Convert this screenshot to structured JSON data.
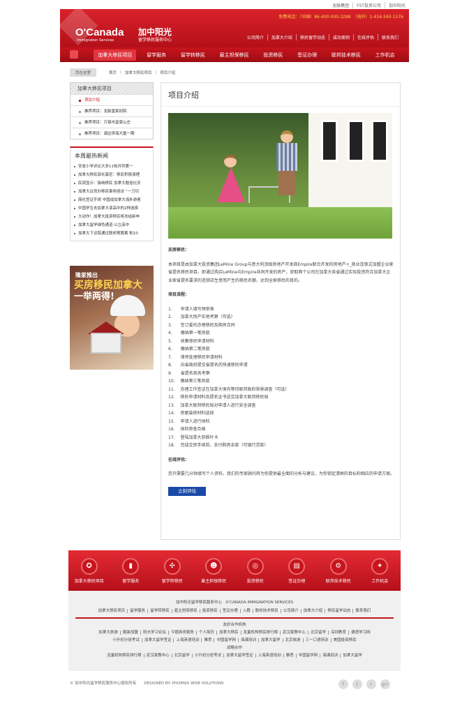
{
  "top_links": [
    "龙脉集团",
    "FST投资公司",
    "加中阳光"
  ],
  "header": {
    "logo_en": "O'Canada",
    "logo_sub": "Immigration Services",
    "logo_cn": "加中阳光",
    "logo_cn_sub": "留学移民服务中心",
    "phone": "免费电话：（中国）86-400-000-3288　（海外）1-416-590-1576",
    "subnav": [
      "公司简介",
      "加拿大介绍",
      "移民留学动态",
      "成功案例",
      "在线评估",
      "联系我们"
    ]
  },
  "main_nav": [
    "加拿大移民项目",
    "留学服务",
    "留学转移民",
    "雇主担保移民",
    "投资移民",
    "签证办理",
    "联邦技术移民",
    "工作机会"
  ],
  "breadcrumb": {
    "loc": "您在这里",
    "items": [
      "首页",
      "加拿大移民项目",
      "项目介绍"
    ]
  },
  "sidebar": {
    "title": "加拿大移民项目",
    "items": [
      "项目介绍",
      "推荐项目：龙脉皇家别院",
      "推荐项目：万锦市富豪山庄",
      "推荐项目：湖边滨海大厦一期"
    ]
  },
  "news": {
    "title": "本周最热新闻",
    "items": [
      "安省小学评比大多11校并列第一",
      "加拿大移民部长康尼：移民积极清理",
      "民调显示：接纳移民 加拿大魁省比安",
      "加拿大议员办移民事务座谈 “一刀切",
      "简化签证手续 中国成加拿大海外游客",
      "中国学生去加拿大读高中的2种选择",
      "大动作！加拿大投资移民将冻结新申",
      "加拿大留学绿色通道·公立高中",
      "加拿大下议院通过联邦预算案 削10"
    ]
  },
  "ad": {
    "t1": "隆家推出",
    "t2": "买房移民加拿大",
    "t3": "一举两得!"
  },
  "main": {
    "title": "项目介绍",
    "s1_title": "买房移民：",
    "s1_text": "本项目是由加拿大投资集团LeMine Group与意大利顶级房地产开发商Empire联合开发的房地产+_商业连锁式加盟企业家省提名移民项目。即通过购买LeMine与Empire共同开发的房产，获取两个公司在加拿大各省通过实际投资符合加拿大企业家省提名要求的连锁店生意而产生的移民名额，达到全家移民的目的。",
    "s2_title": "项目流程：",
    "steps": [
      "1.　　申请人填写预审表",
      "2.　　加拿大房产实地考察（可选）",
      "3.　　签订委托办理移民及购房合同",
      "4.　　缴纳第一笔房款",
      "5.　　收集移民申请材料",
      "6.　　缴纳第二笔房款",
      "7.　　律师处理移民申请材料",
      "8.　　向省政府提交省提名的快速移民申请",
      "9.　　省提名商务考察",
      "10.　 缴纳第三笔房款",
      "11.　 办理工作签证在加拿大境内等待联邦政府背景调查（可选）",
      "12.　 移民申请材料及提名证书送交加拿大联邦移民局",
      "13.　 加拿大联邦移民局对申请人进行安全调查",
      "14.　 房屋装修材料选择",
      "15.　 申请人进行体检",
      "16.　 体检审查合格",
      "17.　 登陆加拿大获枫叶卡",
      "18.　 完成交房手续前，支付购房余款（可银行贷款）"
    ],
    "s3_title": "在线评估：",
    "s3_text": "您只需要几分钟填写个人资料，我们的专家顾问将为你提供最全面的分析与建议，为你锁定清晰的目标和相应的申请方案。",
    "button": "立刻评估"
  },
  "iconbar": [
    {
      "label": "加拿大移民项目",
      "icon": "thumb-icon"
    },
    {
      "label": "留学服务",
      "icon": "chart-icon"
    },
    {
      "label": "留学转移民",
      "icon": "share-icon"
    },
    {
      "label": "雇主担保移民",
      "icon": "people-icon"
    },
    {
      "label": "投资移民",
      "icon": "globe-icon"
    },
    {
      "label": "签证办理",
      "icon": "book-icon"
    },
    {
      "label": "联邦技术移民",
      "icon": "gear-icon"
    },
    {
      "label": "工作机会",
      "icon": "thumbs-up-icon"
    }
  ],
  "footer": {
    "company": "加中阳光留学移民服务中心　O'CANADA IMMIGRATION SERVICES",
    "links": [
      "加拿大移民项目",
      "留学服务",
      "留学转移民",
      "雇主担保移民",
      "投资移民",
      "签证办理",
      "入籍",
      "联邦技术移民",
      "公司简介",
      "加拿大介绍",
      "移民留学动态",
      "联系我们"
    ],
    "partners_title": "友好合作机构",
    "partners1": [
      "加拿大旅游",
      "服装加盟",
      "阳光学习论坛",
      "今题商务服务",
      "个人简历",
      "加拿大移民",
      "龙巢机构移民排行榜",
      "武汉家教中心",
      "北京留学",
      "深圳教育",
      "德语学习网"
    ],
    "partners2": [
      "小升初分班考试",
      "加拿大留学签证",
      "上海英语培训",
      "雅思",
      "中国留学网",
      "海课培训",
      "加拿大留学",
      "北京旅游",
      "三一口语培训",
      "美国投资移民"
    ],
    "strategic_title": "战略合作",
    "partners3": [
      "龙巢机构移民排行榜",
      "武汉家教中心",
      "北京留学",
      "小升初分班考试",
      "加拿大留学签证",
      "上海英语培训",
      "雅思",
      "中国留学网",
      "海课培训",
      "加拿大留学"
    ],
    "copyright": "© 加中阳光留学移民服务中心版权所有　　DESIGNED BY: PHOENIX WISE SOLUTIONS"
  },
  "social": [
    {
      "icon": "facebook-icon",
      "glyph": "f"
    },
    {
      "icon": "twitter-icon",
      "glyph": "t"
    },
    {
      "icon": "rss-icon",
      "glyph": "r"
    },
    {
      "icon": "googleplus-icon",
      "glyph": "g+"
    }
  ]
}
